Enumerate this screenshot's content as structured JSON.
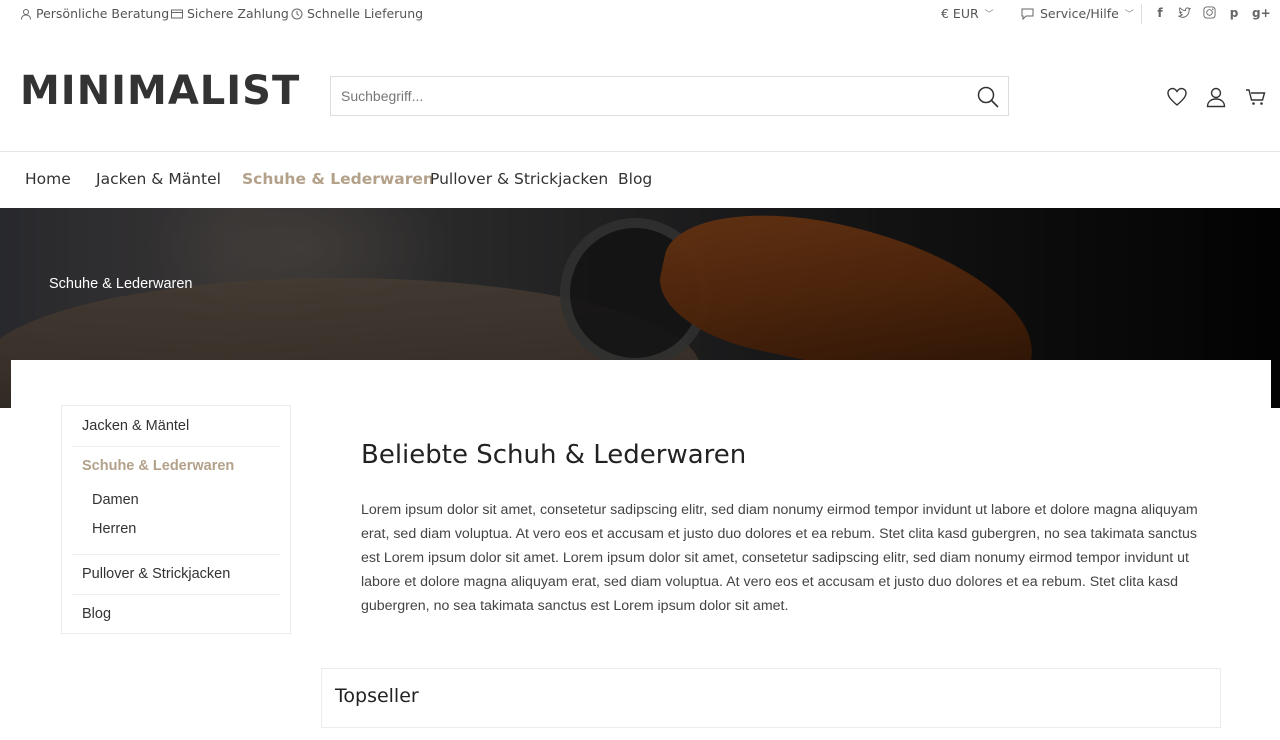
{
  "topbar": {
    "usps": [
      "Persönliche Beratung",
      "Sichere Zahlung",
      "Schnelle Lieferung"
    ],
    "currency": "€ EUR",
    "service": "Service/Hilfe",
    "social_icons": [
      "facebook-icon",
      "twitter-icon",
      "instagram-icon",
      "pinterest-icon",
      "google-plus-icon"
    ]
  },
  "header": {
    "logo": "MINIMALIST",
    "search_placeholder": "Suchbegriff..."
  },
  "nav": {
    "items": [
      "Home",
      "Jacken & Mäntel",
      "Schuhe & Lederwaren",
      "Pullover & Strickjacken",
      "Blog"
    ],
    "active": "Schuhe & Lederwaren"
  },
  "hero": {
    "title": "Schuhe & Lederwaren"
  },
  "sidebar": {
    "items": [
      "Jacken & Mäntel",
      "Schuhe & Lederwaren",
      "Pullover & Strickjacken",
      "Blog"
    ],
    "subitems": [
      "Damen",
      "Herren"
    ]
  },
  "content": {
    "headline": "Beliebte Schuh & Lederwaren",
    "text": "Lorem ipsum dolor sit amet, consetetur sadipscing elitr, sed diam nonumy eirmod tempor invidunt ut labore et dolore magna aliquyam erat, sed diam voluptua. At vero eos et accusam et justo duo dolores et ea rebum. Stet clita kasd gubergren, no sea takimata sanctus est Lorem ipsum dolor sit amet. Lorem ipsum dolor sit amet, consetetur sadipscing elitr, sed diam nonumy eirmod tempor invidunt ut labore et dolore magna aliquyam erat, sed diam voluptua. At vero eos et accusam et justo duo dolores et ea rebum. Stet clita kasd gubergren, no sea takimata sanctus est Lorem ipsum dolor sit amet.",
    "topseller": "Topseller"
  },
  "colors": {
    "accent": "#b3a18a",
    "text": "#333333",
    "border": "#e5e5e5"
  }
}
